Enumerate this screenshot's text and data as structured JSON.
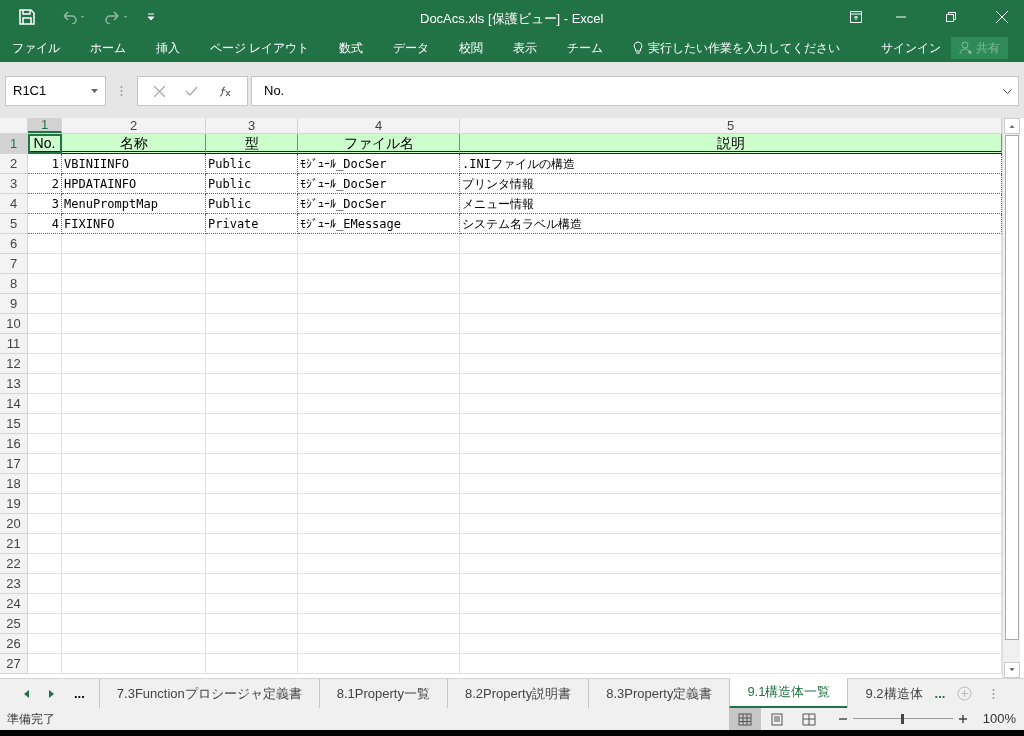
{
  "window": {
    "title": "DocAcs.xls  [保護ビュー] - Excel"
  },
  "ribbon_tabs": [
    {
      "label": "ファイル"
    },
    {
      "label": "ホーム"
    },
    {
      "label": "挿入"
    },
    {
      "label": "ページ レイアウト"
    },
    {
      "label": "数式"
    },
    {
      "label": "データ"
    },
    {
      "label": "校閲"
    },
    {
      "label": "表示"
    },
    {
      "label": "チーム"
    }
  ],
  "tell_me": {
    "placeholder": "実行したい作業を入力してください"
  },
  "sign_in": "サインイン",
  "share": {
    "label": "共有",
    "disabled": true
  },
  "name_box": {
    "value": "R1C1"
  },
  "formula_bar": {
    "value": "No."
  },
  "sheet": {
    "column_headers": [
      "1",
      "2",
      "3",
      "4",
      "5"
    ],
    "rows": [
      {
        "number": "1",
        "kind": "header",
        "cells": [
          {
            "text": "No.",
            "selected": true
          },
          {
            "text": "名称",
            "selected": false
          },
          {
            "text": "型",
            "selected": false
          },
          {
            "text": "ファイル名",
            "selected": false
          },
          {
            "text": "説明",
            "selected": false
          }
        ]
      },
      {
        "number": "2",
        "kind": "data",
        "cells": [
          {
            "text": "1",
            "selected": false
          },
          {
            "text": "VBINIINFO",
            "selected": false
          },
          {
            "text": "Public",
            "selected": false
          },
          {
            "text": "ﾓｼﾞｭｰﾙ_DocSer",
            "selected": false
          },
          {
            "text": ".INIファイルの構造",
            "selected": false
          }
        ]
      },
      {
        "number": "3",
        "kind": "data",
        "cells": [
          {
            "text": "2",
            "selected": false
          },
          {
            "text": "HPDATAINFO",
            "selected": false
          },
          {
            "text": "Public",
            "selected": false
          },
          {
            "text": "ﾓｼﾞｭｰﾙ_DocSer",
            "selected": false
          },
          {
            "text": "プリンタ情報",
            "selected": false
          }
        ]
      },
      {
        "number": "4",
        "kind": "data",
        "cells": [
          {
            "text": "3",
            "selected": false
          },
          {
            "text": "MenuPromptMap",
            "selected": false
          },
          {
            "text": "Public",
            "selected": false
          },
          {
            "text": "ﾓｼﾞｭｰﾙ_DocSer",
            "selected": false
          },
          {
            "text": "メニュー情報",
            "selected": false
          }
        ]
      },
      {
        "number": "5",
        "kind": "data",
        "cells": [
          {
            "text": "4",
            "selected": false
          },
          {
            "text": "FIXINFO",
            "selected": false
          },
          {
            "text": "Private",
            "selected": false
          },
          {
            "text": "ﾓｼﾞｭｰﾙ_EMessage",
            "selected": false
          },
          {
            "text": "システム名ラベル構造",
            "selected": false
          }
        ]
      },
      {
        "number": "6",
        "kind": "empty",
        "cells": []
      },
      {
        "number": "7",
        "kind": "empty",
        "cells": []
      },
      {
        "number": "8",
        "kind": "empty",
        "cells": []
      },
      {
        "number": "9",
        "kind": "empty",
        "cells": []
      },
      {
        "number": "10",
        "kind": "empty",
        "cells": []
      },
      {
        "number": "11",
        "kind": "empty",
        "cells": []
      },
      {
        "number": "12",
        "kind": "empty",
        "cells": []
      },
      {
        "number": "13",
        "kind": "empty",
        "cells": []
      },
      {
        "number": "14",
        "kind": "empty",
        "cells": []
      },
      {
        "number": "15",
        "kind": "empty",
        "cells": []
      },
      {
        "number": "16",
        "kind": "empty",
        "cells": []
      },
      {
        "number": "17",
        "kind": "empty",
        "cells": []
      },
      {
        "number": "18",
        "kind": "empty",
        "cells": []
      },
      {
        "number": "19",
        "kind": "empty",
        "cells": []
      },
      {
        "number": "20",
        "kind": "empty",
        "cells": []
      },
      {
        "number": "21",
        "kind": "empty",
        "cells": []
      },
      {
        "number": "22",
        "kind": "empty",
        "cells": []
      },
      {
        "number": "23",
        "kind": "empty",
        "cells": []
      },
      {
        "number": "24",
        "kind": "empty",
        "cells": []
      },
      {
        "number": "25",
        "kind": "empty",
        "cells": []
      },
      {
        "number": "26",
        "kind": "empty",
        "cells": []
      },
      {
        "number": "27",
        "kind": "empty",
        "cells": []
      }
    ]
  },
  "sheet_tabs": {
    "more_left": "...",
    "tabs": [
      {
        "label": "7.3Functionプロシージャ定義書",
        "selected": false
      },
      {
        "label": "8.1Property一覧",
        "selected": false
      },
      {
        "label": "8.2Property説明書",
        "selected": false
      },
      {
        "label": "8.3Property定義書",
        "selected": false
      },
      {
        "label": "9.1構造体一覧",
        "selected": true
      },
      {
        "label": "9.2構造体",
        "selected": false
      }
    ],
    "more_right": "..."
  },
  "status_bar": {
    "status": "準備完了",
    "views": [
      {
        "kind": "normal",
        "selected": true
      },
      {
        "kind": "page_layout",
        "selected": false
      },
      {
        "kind": "page_break",
        "selected": false
      }
    ],
    "zoom": {
      "level": 0.5,
      "reading": "100%"
    }
  }
}
